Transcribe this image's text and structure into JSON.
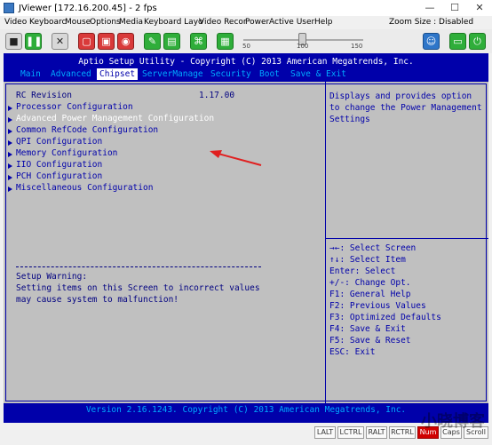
{
  "window": {
    "title": "JViewer [172.16.200.45] - 2 fps",
    "minimize": "—",
    "maximize": "☐",
    "close": "✕"
  },
  "menubar": {
    "items": [
      "Video",
      "Keyboarc",
      "Mouse",
      "Options",
      "Media",
      "Keyboard Layo",
      "Video Recor",
      "Power",
      "Active User",
      "Help"
    ],
    "zoom_label": "Zoom Size : Disabled"
  },
  "toolbar": {
    "slider_ticks": [
      "50",
      "100",
      "150"
    ],
    "slider_value_percent": 100
  },
  "bios": {
    "header": "Aptio Setup Utility - Copyright (C) 2013 American Megatrends, Inc.",
    "tabs": [
      "Main",
      "Advanced",
      "Chipset",
      "ServerManage",
      "Security",
      "Boot",
      "Save & Exit"
    ],
    "active_tab": "Chipset",
    "rc_label": "RC Revision",
    "rc_value": "1.17.00",
    "menu_items": [
      "Processor Configuration",
      "Advanced Power Management Configuration",
      "Common RefCode Configuration",
      "QPI Configuration",
      "Memory Configuration",
      "IIO Configuration",
      "PCH Configuration",
      "Miscellaneous Configuration"
    ],
    "selected_item": "Advanced Power Management Configuration",
    "warning_title": "Setup Warning:",
    "warning_line1": "Setting items on this Screen to incorrect values",
    "warning_line2": "may cause system to malfunction!",
    "help_text": [
      "Displays and provides option",
      "to change the Power Management",
      "Settings"
    ],
    "key_help": [
      "→←: Select Screen",
      "↑↓: Select Item",
      "Enter: Select",
      "+/-: Change Opt.",
      "F1: General Help",
      "F2: Previous Values",
      "F3: Optimized Defaults",
      "F4: Save & Exit",
      "F5: Save & Reset",
      "ESC: Exit"
    ],
    "footer": "Version 2.16.1243. Copyright (C) 2013 American Megatrends, Inc."
  },
  "statusbar": {
    "keys": [
      "LALT",
      "LCTRL",
      "RALT",
      "RCTRL",
      "Num",
      "Caps",
      "Scroll"
    ],
    "active_key": "Num"
  },
  "watermark": "小晓博客",
  "colors": {
    "bios_blue": "#0000aa",
    "bios_gray": "#c0c0c0",
    "selected_text": "#ffffff",
    "annotation_arrow": "#e02020"
  }
}
